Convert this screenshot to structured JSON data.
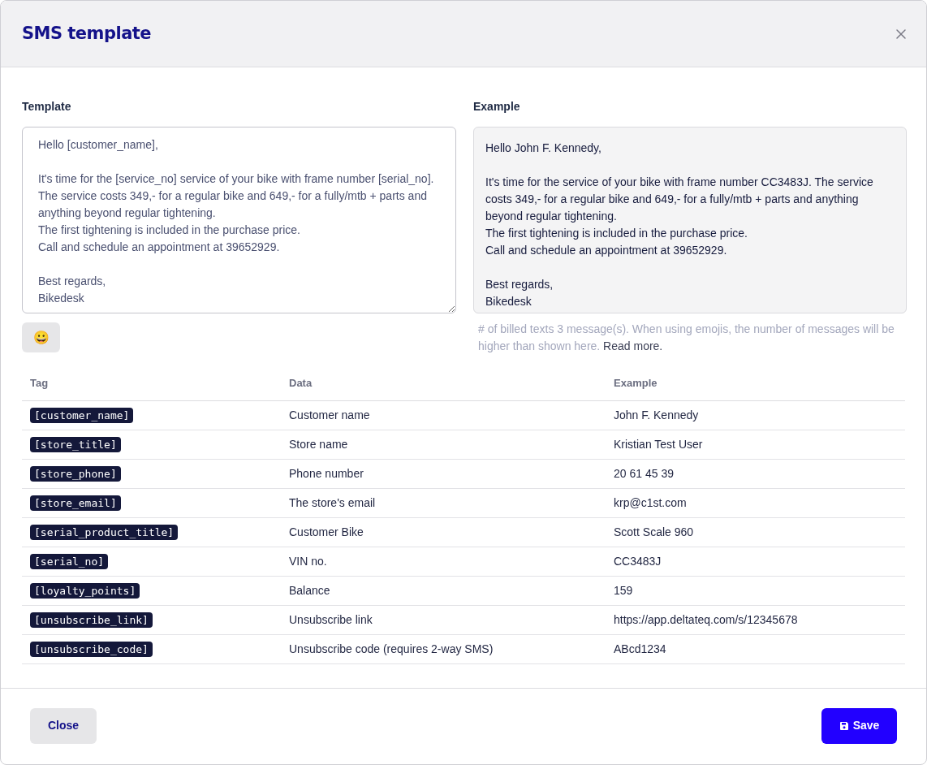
{
  "dialog": {
    "title": "SMS template"
  },
  "template": {
    "label": "Template",
    "value": "Hello [customer_name],\n\nIt's time for the [service_no] service of your bike with frame number [serial_no]. The service costs 349,- for a regular bike and 649,- for a fully/mtb + parts and anything beyond regular tightening.\nThe first tightening is included in the purchase price.\nCall and schedule an appointment at 39652929.\n\nBest regards,\nBikedesk"
  },
  "emoji_button": {
    "label": "😀"
  },
  "example": {
    "label": "Example",
    "text": "Hello John F. Kennedy,\n\nIt's time for the service of your bike with frame number CC3483J. The service costs 349,- for a regular bike and 649,- for a fully/mtb + parts and anything beyond regular tightening.\nThe first tightening is included in the purchase price.\nCall and schedule an appointment at 39652929.\n\nBest regards,\nBikedesk"
  },
  "billing_note": {
    "text": "# of billed texts 3 message(s). When using emojis, the number of messages will be higher than shown here.",
    "link": "Read more."
  },
  "table": {
    "columns": [
      "Tag",
      "Data",
      "Example"
    ],
    "rows": [
      {
        "tag": "[customer_name]",
        "data": "Customer name",
        "example": "John F. Kennedy"
      },
      {
        "tag": "[store_title]",
        "data": "Store name",
        "example": "Kristian Test User"
      },
      {
        "tag": "[store_phone]",
        "data": "Phone number",
        "example": "20 61 45 39"
      },
      {
        "tag": "[store_email]",
        "data": "The store's email",
        "example": "krp@c1st.com"
      },
      {
        "tag": "[serial_product_title]",
        "data": "Customer Bike",
        "example": "Scott Scale 960"
      },
      {
        "tag": "[serial_no]",
        "data": "VIN no.",
        "example": "CC3483J"
      },
      {
        "tag": "[loyalty_points]",
        "data": "Balance",
        "example": "159"
      },
      {
        "tag": "[unsubscribe_link]",
        "data": "Unsubscribe link",
        "example": "https://app.deltateq.com/s/12345678"
      },
      {
        "tag": "[unsubscribe_code]",
        "data": "Unsubscribe code (requires 2-way SMS)",
        "example": "ABcd1234"
      }
    ]
  },
  "footer": {
    "close": "Close",
    "save": "Save"
  }
}
